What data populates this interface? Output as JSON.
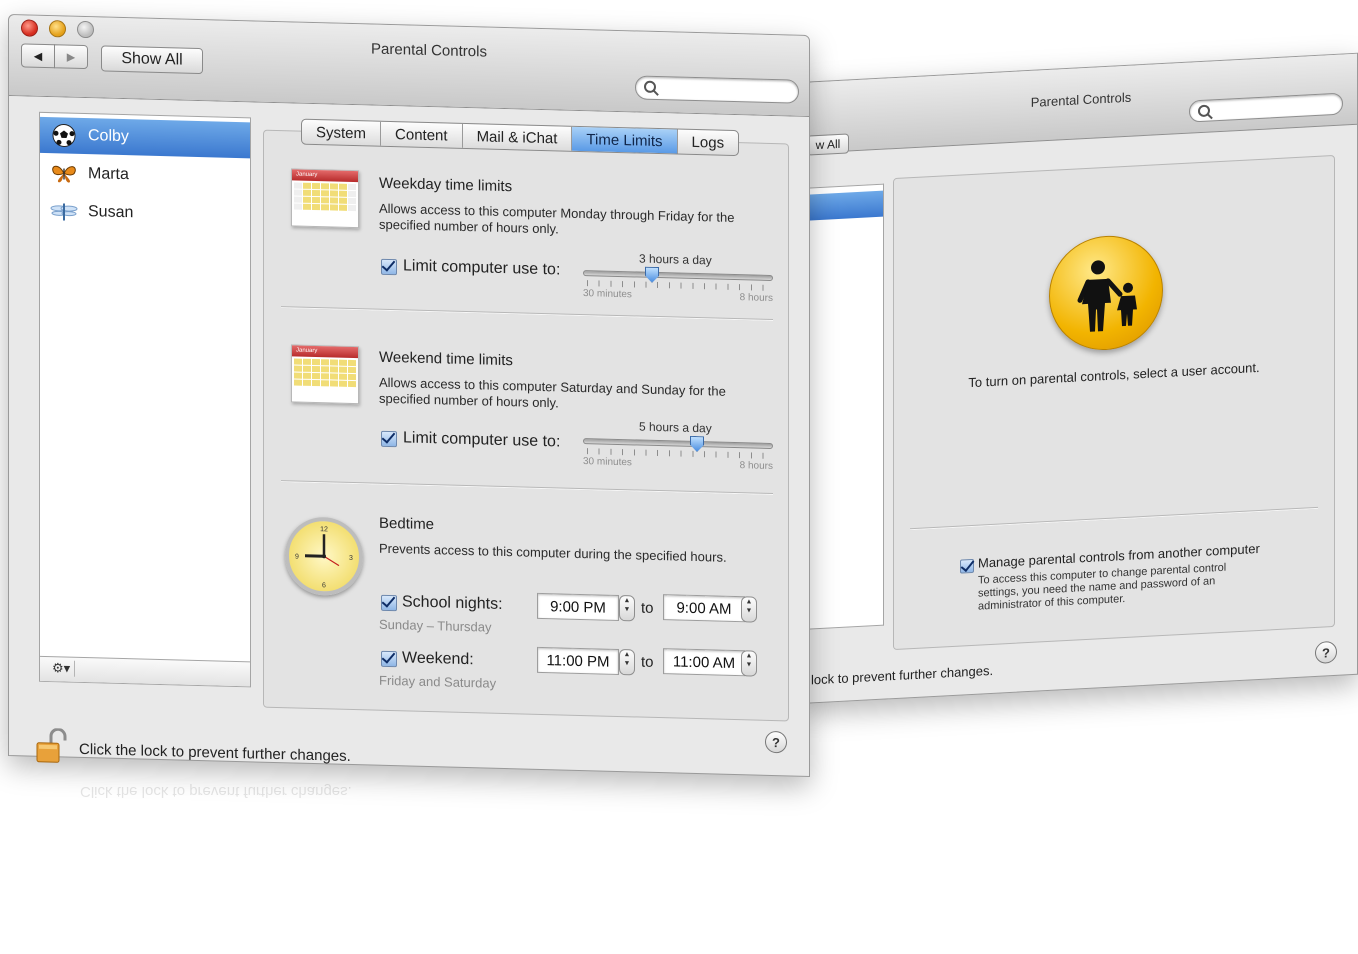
{
  "main_window": {
    "title": "Parental Controls",
    "nav": {
      "back": "◀",
      "forward": "▶",
      "show_all": "Show All"
    },
    "search": {
      "placeholder": ""
    },
    "users": [
      {
        "name": "Colby",
        "icon": "soccer-ball-icon",
        "selected": true
      },
      {
        "name": "Marta",
        "icon": "butterfly-icon",
        "selected": false
      },
      {
        "name": "Susan",
        "icon": "dragonfly-icon",
        "selected": false
      }
    ],
    "gear": "⚙▾",
    "tabs": [
      {
        "label": "System",
        "active": false
      },
      {
        "label": "Content",
        "active": false
      },
      {
        "label": "Mail & iChat",
        "active": false
      },
      {
        "label": "Time Limits",
        "active": true
      },
      {
        "label": "Logs",
        "active": false
      }
    ],
    "weekday": {
      "calendar_month": "January",
      "title": "Weekday time limits",
      "description": "Allows access to this computer Monday through Friday for the specified number of hours only.",
      "checkbox_label": "Limit computer use to:",
      "checked": true,
      "value_label": "3 hours a day",
      "slider_fraction": 0.35,
      "min_label": "30 minutes",
      "max_label": "8 hours"
    },
    "weekend": {
      "calendar_month": "January",
      "title": "Weekend time limits",
      "description": "Allows access to this computer Saturday and Sunday for the specified number of hours only.",
      "checkbox_label": "Limit computer use to:",
      "checked": true,
      "value_label": "5 hours a day",
      "slider_fraction": 0.6,
      "min_label": "30 minutes",
      "max_label": "8 hours"
    },
    "bedtime": {
      "title": "Bedtime",
      "description": "Prevents access to this computer during the specified hours.",
      "school_nights": {
        "label": "School nights:",
        "checked": true,
        "sub": "Sunday – Thursday",
        "from": "9:00 PM",
        "to_word": "to",
        "to": "9:00 AM"
      },
      "weekend": {
        "label": "Weekend:",
        "checked": true,
        "sub": "Friday and Saturday",
        "from": "11:00 PM",
        "to_word": "to",
        "to": "11:00 AM"
      }
    },
    "help": "?",
    "lock_text": "Click the lock to prevent further changes."
  },
  "back_window": {
    "title": "Parental Controls",
    "show_all_fragment": "w All",
    "message": "To turn on parental controls, select a user account.",
    "manage": {
      "label": "Manage parental controls from another computer",
      "checked": true,
      "description": "To access this computer to change parental control settings, you need the name and password of an administrator of this computer."
    },
    "lock_text_fragment": "lock to prevent further changes.",
    "help": "?"
  },
  "colors": {
    "selection": "#3b78cf",
    "tab_active": "#5a9ae6",
    "accent_yellow": "#f2b400"
  }
}
